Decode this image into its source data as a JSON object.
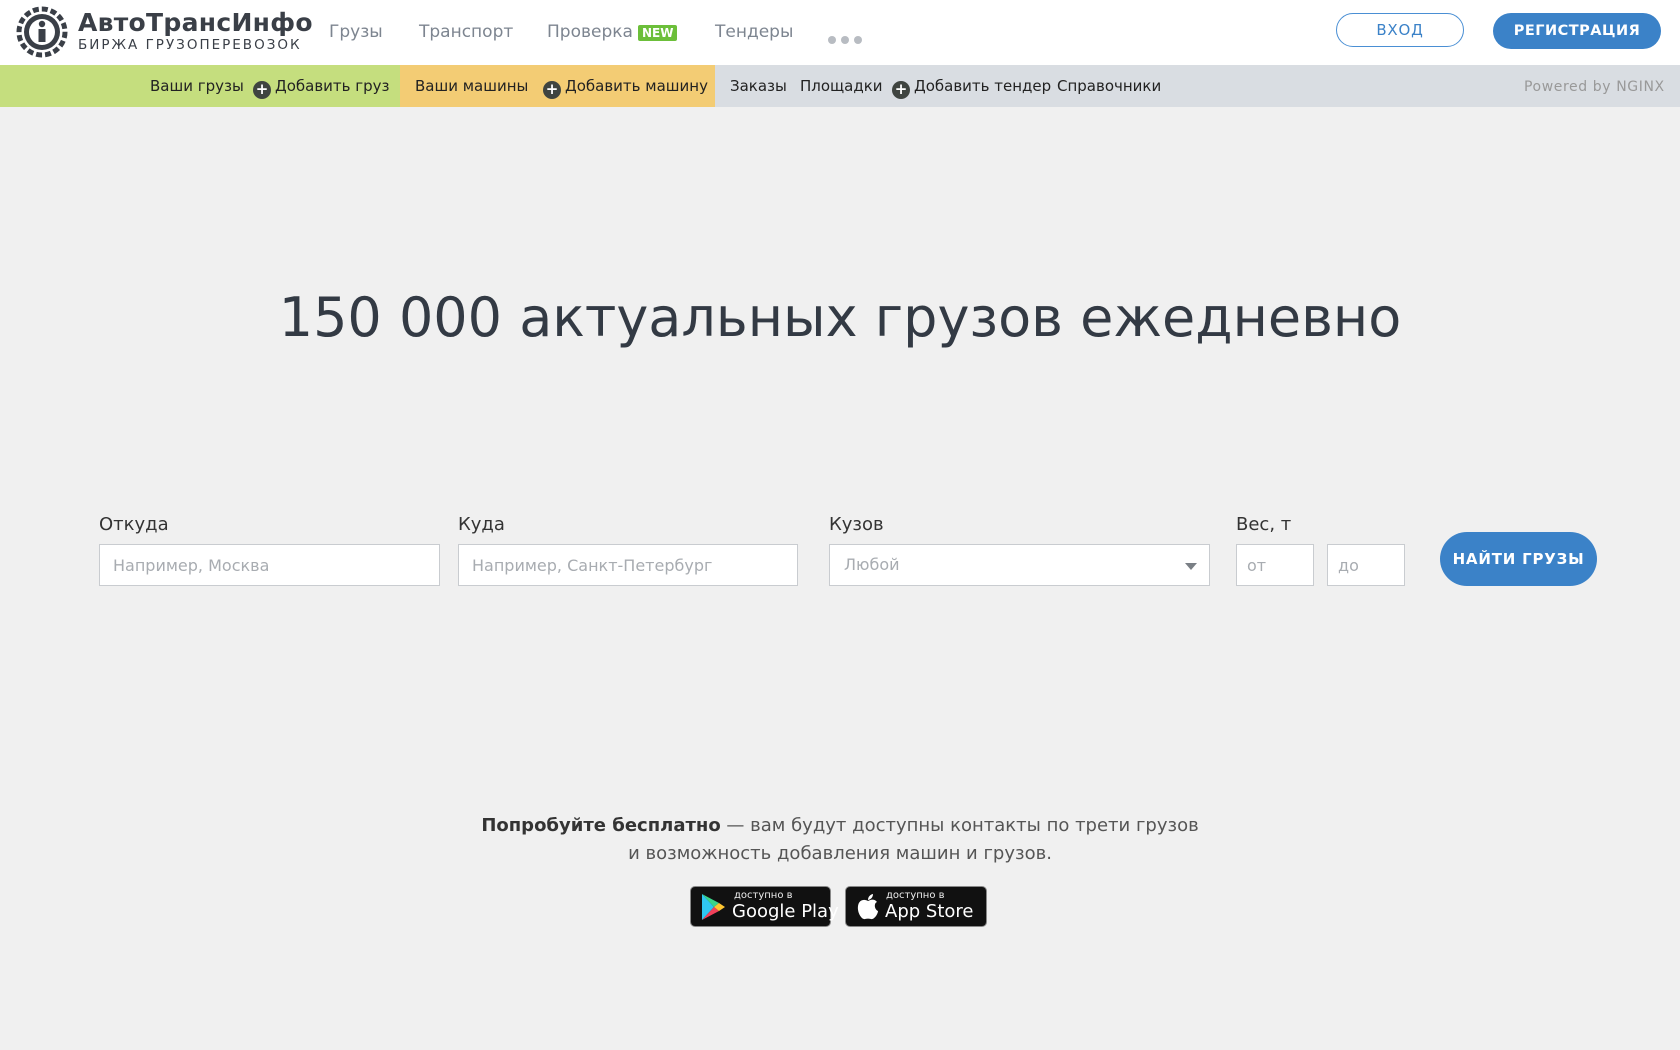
{
  "header": {
    "logo": {
      "name": "АвтоТрансИнфо",
      "subtitle": "БИРЖА ГРУЗОПЕРЕВОЗОК",
      "icon": "ati-logo-icon"
    },
    "nav": [
      {
        "label": "Грузы"
      },
      {
        "label": "Транспорт"
      },
      {
        "label": "Проверка",
        "badge": "NEW"
      },
      {
        "label": "Тендеры"
      }
    ],
    "more_icon": "more-dots-icon",
    "login_label": "ВХОД",
    "register_label": "РЕГИСТРАЦИЯ"
  },
  "subnav": {
    "cargo": {
      "your_label": "Ваши грузы",
      "add_label": "Добавить груз"
    },
    "trucks": {
      "your_label": "Ваши машины",
      "add_label": "Добавить машину"
    },
    "orders_label": "Заказы",
    "platforms_label": "Площадки",
    "add_tender_label": "Добавить тендер",
    "references_label": "Справочники",
    "powered_by": "Powered by NGINX"
  },
  "hero": {
    "title": "150 000 актуальных грузов ежедневно"
  },
  "search": {
    "from": {
      "label": "Откуда",
      "placeholder": "Например, Москва",
      "value": ""
    },
    "to": {
      "label": "Куда",
      "placeholder": "Например, Санкт-Петербург",
      "value": ""
    },
    "body": {
      "label": "Кузов",
      "value": "Любой"
    },
    "weight": {
      "label": "Вес, т",
      "from_placeholder": "от",
      "to_placeholder": "до"
    },
    "submit_label": "НАЙТИ ГРУЗЫ"
  },
  "promo": {
    "bold": "Попробуйте бесплатно",
    "text1": " — вам будут доступны контакты по трети грузов",
    "text2": "и возможность добавления машин и грузов."
  },
  "apps": {
    "google": {
      "small": "доступно в",
      "big": "Google Play"
    },
    "apple": {
      "small": "доступно в",
      "big": "App Store"
    }
  },
  "colors": {
    "accent": "#3b82c8",
    "cargo_bar": "#c5de7e",
    "trucks_bar": "#f3cc74",
    "subnav_bg": "#d9dde2",
    "new_badge": "#6cbf3a",
    "page_bg": "#f0f0f0"
  }
}
